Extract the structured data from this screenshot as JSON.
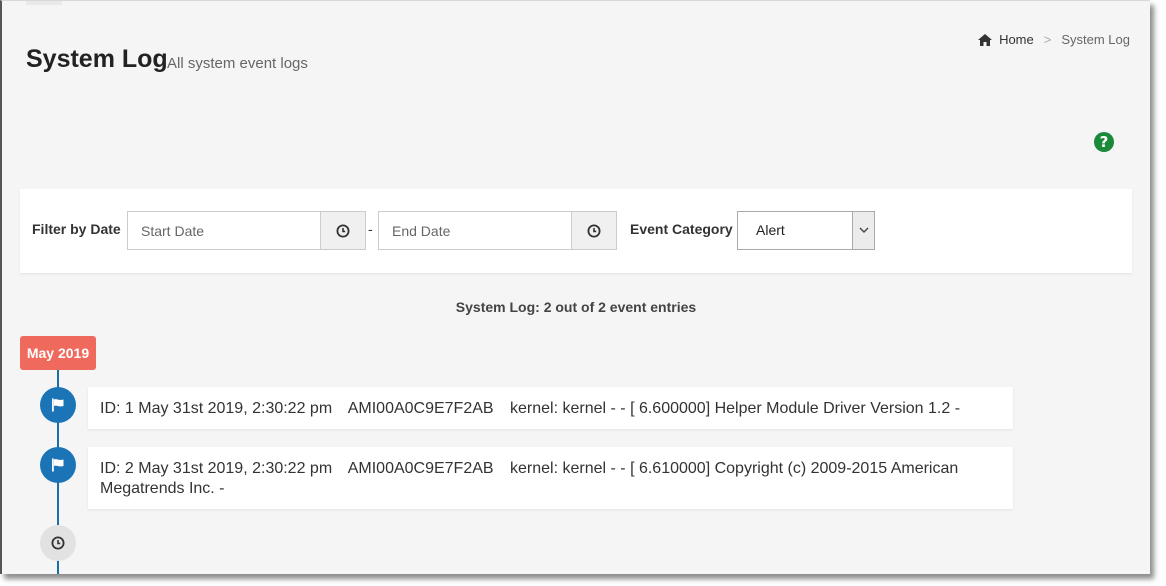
{
  "header": {
    "title": "System Log",
    "subtitle": "All system event logs"
  },
  "breadcrumb": {
    "home_label": "Home",
    "separator": ">",
    "current_label": "System Log"
  },
  "help": {
    "label": "?"
  },
  "filter": {
    "date_label": "Filter by Date",
    "start_placeholder": "Start Date",
    "start_value": "",
    "range_separator": "-",
    "end_placeholder": "End Date",
    "end_value": "",
    "category_label": "Event Category",
    "category_selected": "Alert"
  },
  "summary": "System Log: 2 out of 2 event entries",
  "timeline": {
    "month_badge": "May 2019",
    "entries": [
      {
        "id_label": "ID: 1",
        "timestamp": "May 31st 2019, 2:30:22 pm",
        "source": "AMI00A0C9E7F2AB",
        "message": "kernel: kernel - - [ 6.600000] Helper Module Driver Version 1.2 -"
      },
      {
        "id_label": "ID: 2",
        "timestamp": "May 31st 2019, 2:30:22 pm",
        "source": "AMI00A0C9E7F2AB",
        "message": "kernel: kernel - - [ 6.610000] Copyright (c) 2009-2015 American Megatrends Inc. -"
      }
    ]
  },
  "colors": {
    "badge": "#ef6a5c",
    "timeline": "#1b74b6",
    "help": "#1a8a3a"
  }
}
